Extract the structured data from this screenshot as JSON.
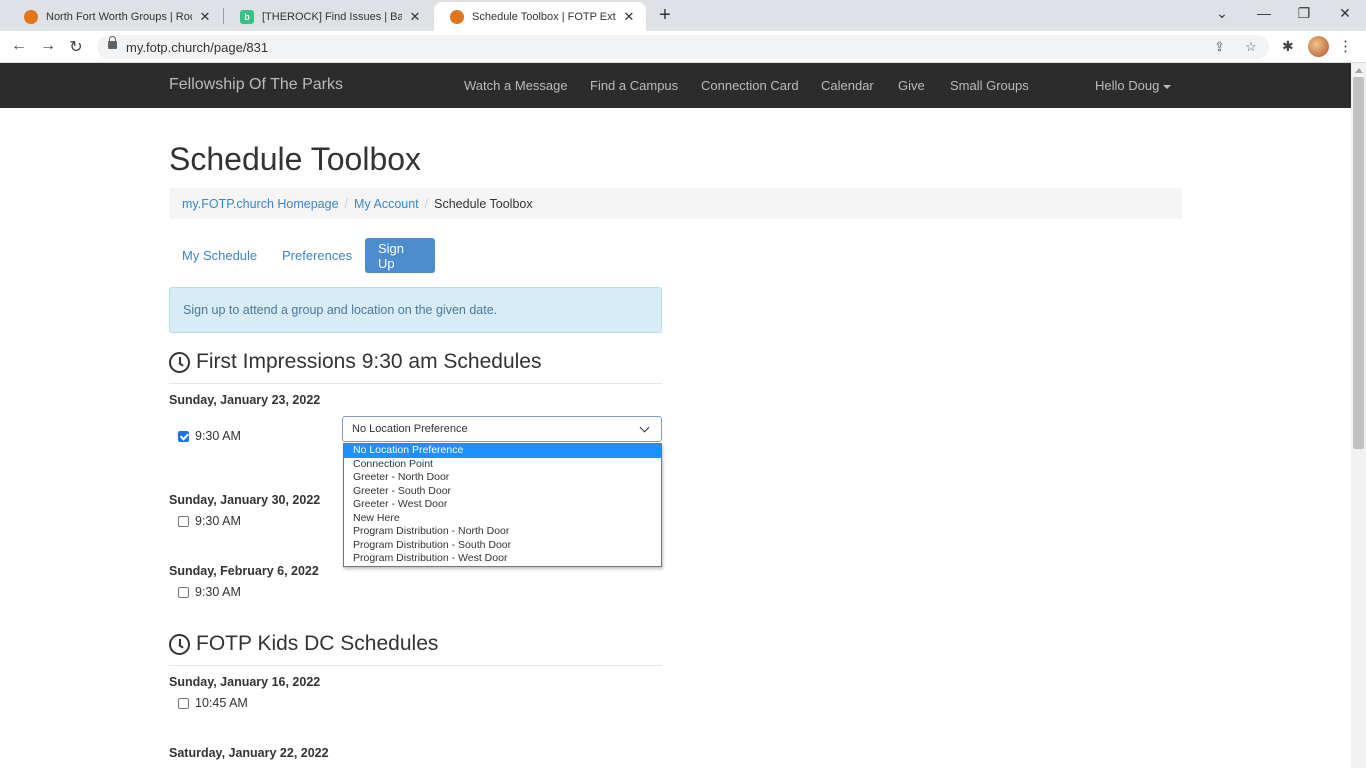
{
  "browser": {
    "tabs": [
      {
        "title": "North Fort Worth Groups | Rock R",
        "favicon": "rock-logo-icon",
        "active": false
      },
      {
        "title": "[THEROCK] Find Issues | Backlog",
        "favicon": "backlog-icon",
        "active": false
      },
      {
        "title": "Schedule Toolbox | FOTP External",
        "favicon": "rock-logo-icon",
        "active": true
      }
    ],
    "favicon_b_letter": "b",
    "close_glyph": "✕",
    "new_tab_glyph": "+",
    "url": "my.fotp.church/page/831",
    "window_controls": {
      "tab_search": "⌄",
      "minimize": "—",
      "restore": "❐",
      "close": "✕"
    },
    "nav": {
      "back": "←",
      "forward": "→",
      "reload": "↻"
    },
    "omnibox_icons": {
      "share": "⇪",
      "bookmark": "☆"
    },
    "extensions_icon": "✱",
    "menu_glyph": "⋮"
  },
  "site": {
    "brand": "Fellowship Of The Parks",
    "nav": [
      "Watch a Message",
      "Find a Campus",
      "Connection Card",
      "Calendar",
      "Give",
      "Small Groups"
    ],
    "user_menu": "Hello Doug"
  },
  "page": {
    "title": "Schedule Toolbox",
    "breadcrumb": {
      "items": [
        "my.FOTP.church Homepage",
        "My Account"
      ],
      "current": "Schedule Toolbox",
      "separator": "/"
    },
    "pills": {
      "my_schedule": "My Schedule",
      "preferences": "Preferences",
      "sign_up": "Sign Up"
    },
    "alert": "Sign up to attend a group and location on the given date.",
    "sections": [
      {
        "title": "First Impressions 9:30 am Schedules",
        "dates": [
          {
            "date": "Sunday, January 23, 2022",
            "time": "9:30 AM",
            "checked": true
          },
          {
            "date": "Sunday, January 30, 2022",
            "time": "9:30 AM",
            "checked": false
          },
          {
            "date": "Sunday, February 6, 2022",
            "time": "9:30 AM",
            "checked": false
          }
        ]
      },
      {
        "title": "FOTP Kids DC Schedules",
        "dates": [
          {
            "date": "Sunday, January 16, 2022",
            "time": "10:45 AM",
            "checked": false
          },
          {
            "date": "Saturday, January 22, 2022"
          }
        ]
      }
    ],
    "location_select": {
      "value": "No Location Preference",
      "options": [
        "No Location Preference",
        "Connection Point",
        "Greeter - North Door",
        "Greeter - South Door",
        "Greeter - West Door",
        "New Here",
        "Program Distribution - North Door",
        "Program Distribution - South Door",
        "Program Distribution - West Door"
      ]
    }
  },
  "colors": {
    "navbar_bg": "#2c2c2c",
    "link": "#3a87c9",
    "active_pill": "#4b8dcf",
    "alert_bg": "#d8ecf7",
    "selected_option": "#1e90ff"
  }
}
